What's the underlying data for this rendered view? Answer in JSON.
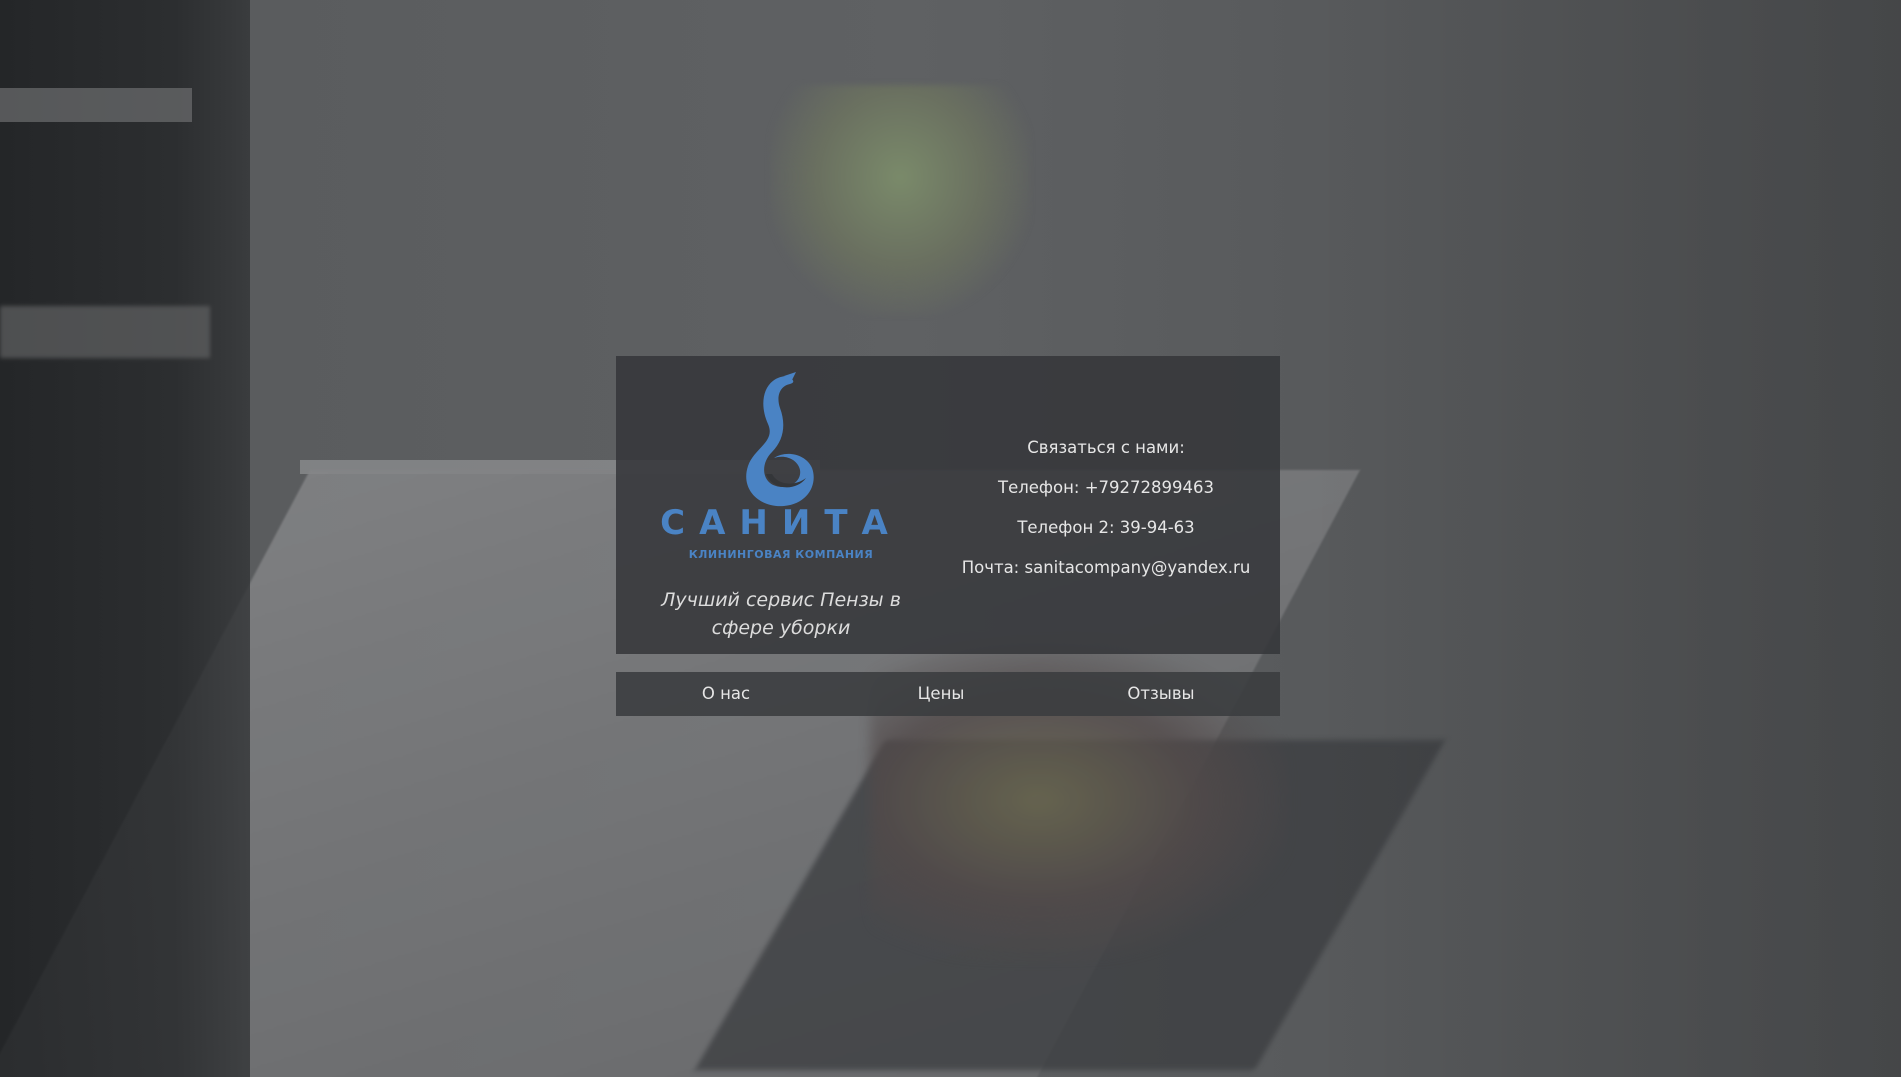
{
  "brand": {
    "name": "САНИТА",
    "tagline": "КЛИНИНГОВАЯ КОМПАНИЯ",
    "logo_icon": "swan-icon",
    "accent_color": "#4a83c4"
  },
  "slogan": "Лучший сервис Пензы в сфере уборки",
  "contacts": {
    "heading": "Связаться с нами:",
    "phone": "Телефон: +79272899463",
    "phone2": "Телефон 2: 39-94-63",
    "email": "Почта: sanitacompany@yandex.ru"
  },
  "nav": {
    "items": [
      {
        "label": "О нас"
      },
      {
        "label": "Цены"
      },
      {
        "label": "Отзывы"
      }
    ]
  }
}
